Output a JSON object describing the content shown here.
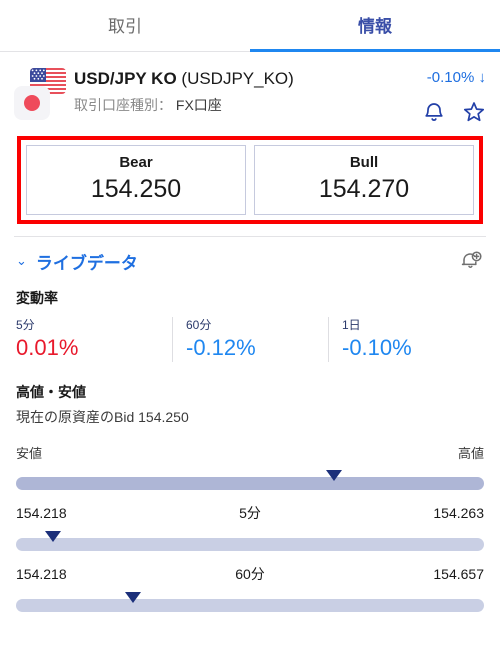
{
  "tabs": [
    {
      "label": "取引",
      "active": false
    },
    {
      "label": "情報",
      "active": true
    }
  ],
  "instrument": {
    "symbol": "USD/JPY KO",
    "code": "(USDJPY_KO)",
    "account_label": "取引口座種別：",
    "account_value": "FX口座",
    "change_pct": "-0.10%",
    "change_arrow": "↓",
    "change_color": "#1f6fe0",
    "flag_left": "jp-flag-icon",
    "flag_right": "us-flag-icon"
  },
  "quotes": [
    {
      "label": "Bear",
      "price": "154.250"
    },
    {
      "label": "Bull",
      "price": "154.270"
    }
  ],
  "highlight_color": "#fb0000",
  "live": {
    "chevron": "⌄",
    "title": "ライブデータ",
    "alert_icon": "bell-plus-icon",
    "change_rate_heading": "変動率",
    "rates": [
      {
        "period": "5分",
        "value": "0.01%",
        "dir": "up"
      },
      {
        "period": "60分",
        "value": "-0.12%",
        "dir": "down"
      },
      {
        "period": "1日",
        "value": "-0.10%",
        "dir": "down"
      }
    ],
    "up_color": "#e8192c",
    "down_color": "#1f87f0"
  },
  "highlow": {
    "heading": "高値・安値",
    "bid_line": "現在の原資産のBid 154.250",
    "cap_low": "安値",
    "cap_high": "高値",
    "sliders": [
      {
        "low": "154.218",
        "period": "5分",
        "high": "154.263",
        "marker_pct": 68,
        "show_caps": true,
        "show_vals": true
      },
      {
        "low": "154.218",
        "period": "60分",
        "high": "154.657",
        "marker_pct": 8,
        "show_caps": false,
        "show_vals": true
      },
      {
        "low": "",
        "period": "",
        "high": "",
        "marker_pct": 25,
        "show_caps": false,
        "show_vals": false
      }
    ]
  }
}
